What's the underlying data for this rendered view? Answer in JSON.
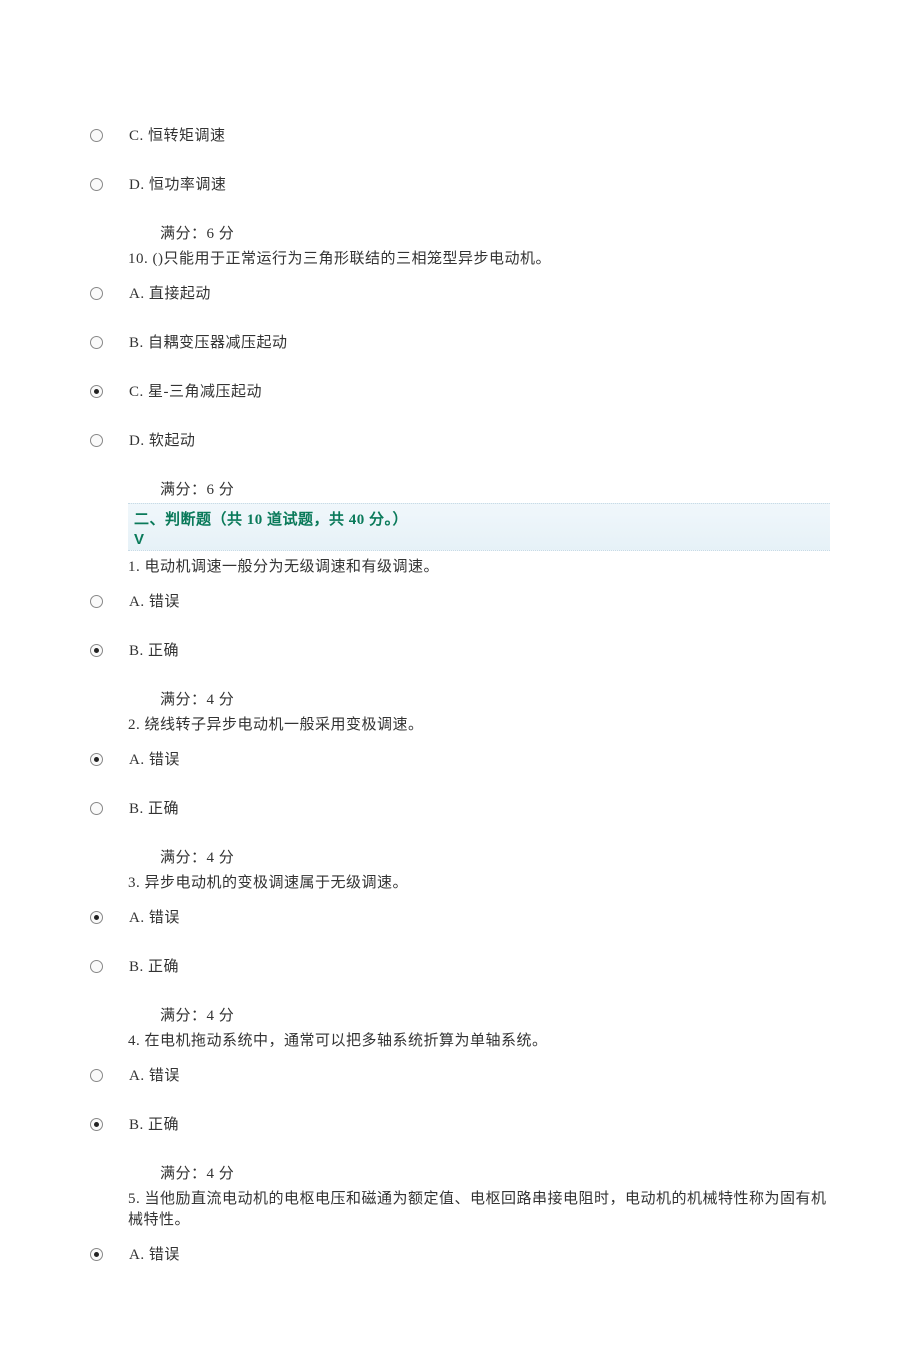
{
  "q9": {
    "optC": "C. 恒转矩调速",
    "optD": "D. 恒功率调速",
    "score": "满分：6 分"
  },
  "q10": {
    "text": "10. ()只能用于正常运行为三角形联结的三相笼型异步电动机。",
    "optA": "A. 直接起动",
    "optB": "B. 自耦变压器减压起动",
    "optC": "C. 星-三角减压起动",
    "optD": "D. 软起动",
    "score": "满分：6 分"
  },
  "section2": {
    "title_a": "二、判断题（共 ",
    "title_b": "10",
    "title_c": " 道试题，共 ",
    "title_d": "40",
    "title_e": " 分。）",
    "v": "V"
  },
  "tf1": {
    "text": "1.  电动机调速一般分为无级调速和有级调速。",
    "optA": "A. 错误",
    "optB": "B. 正确",
    "score": "满分：4 分"
  },
  "tf2": {
    "text": "2.  绕线转子异步电动机一般采用变极调速。",
    "optA": "A. 错误",
    "optB": "B. 正确",
    "score": "满分：4 分"
  },
  "tf3": {
    "text": "3.  异步电动机的变极调速属于无级调速。",
    "optA": "A. 错误",
    "optB": "B. 正确",
    "score": "满分：4 分"
  },
  "tf4": {
    "text": "4.  在电机拖动系统中，通常可以把多轴系统折算为单轴系统。",
    "optA": "A. 错误",
    "optB": "B. 正确",
    "score": "满分：4 分"
  },
  "tf5": {
    "text": "5.  当他励直流电动机的电枢电压和磁通为额定值、电枢回路串接电阻时，电动机的机械特性称为固有机械特性。",
    "optA": "A. 错误"
  }
}
